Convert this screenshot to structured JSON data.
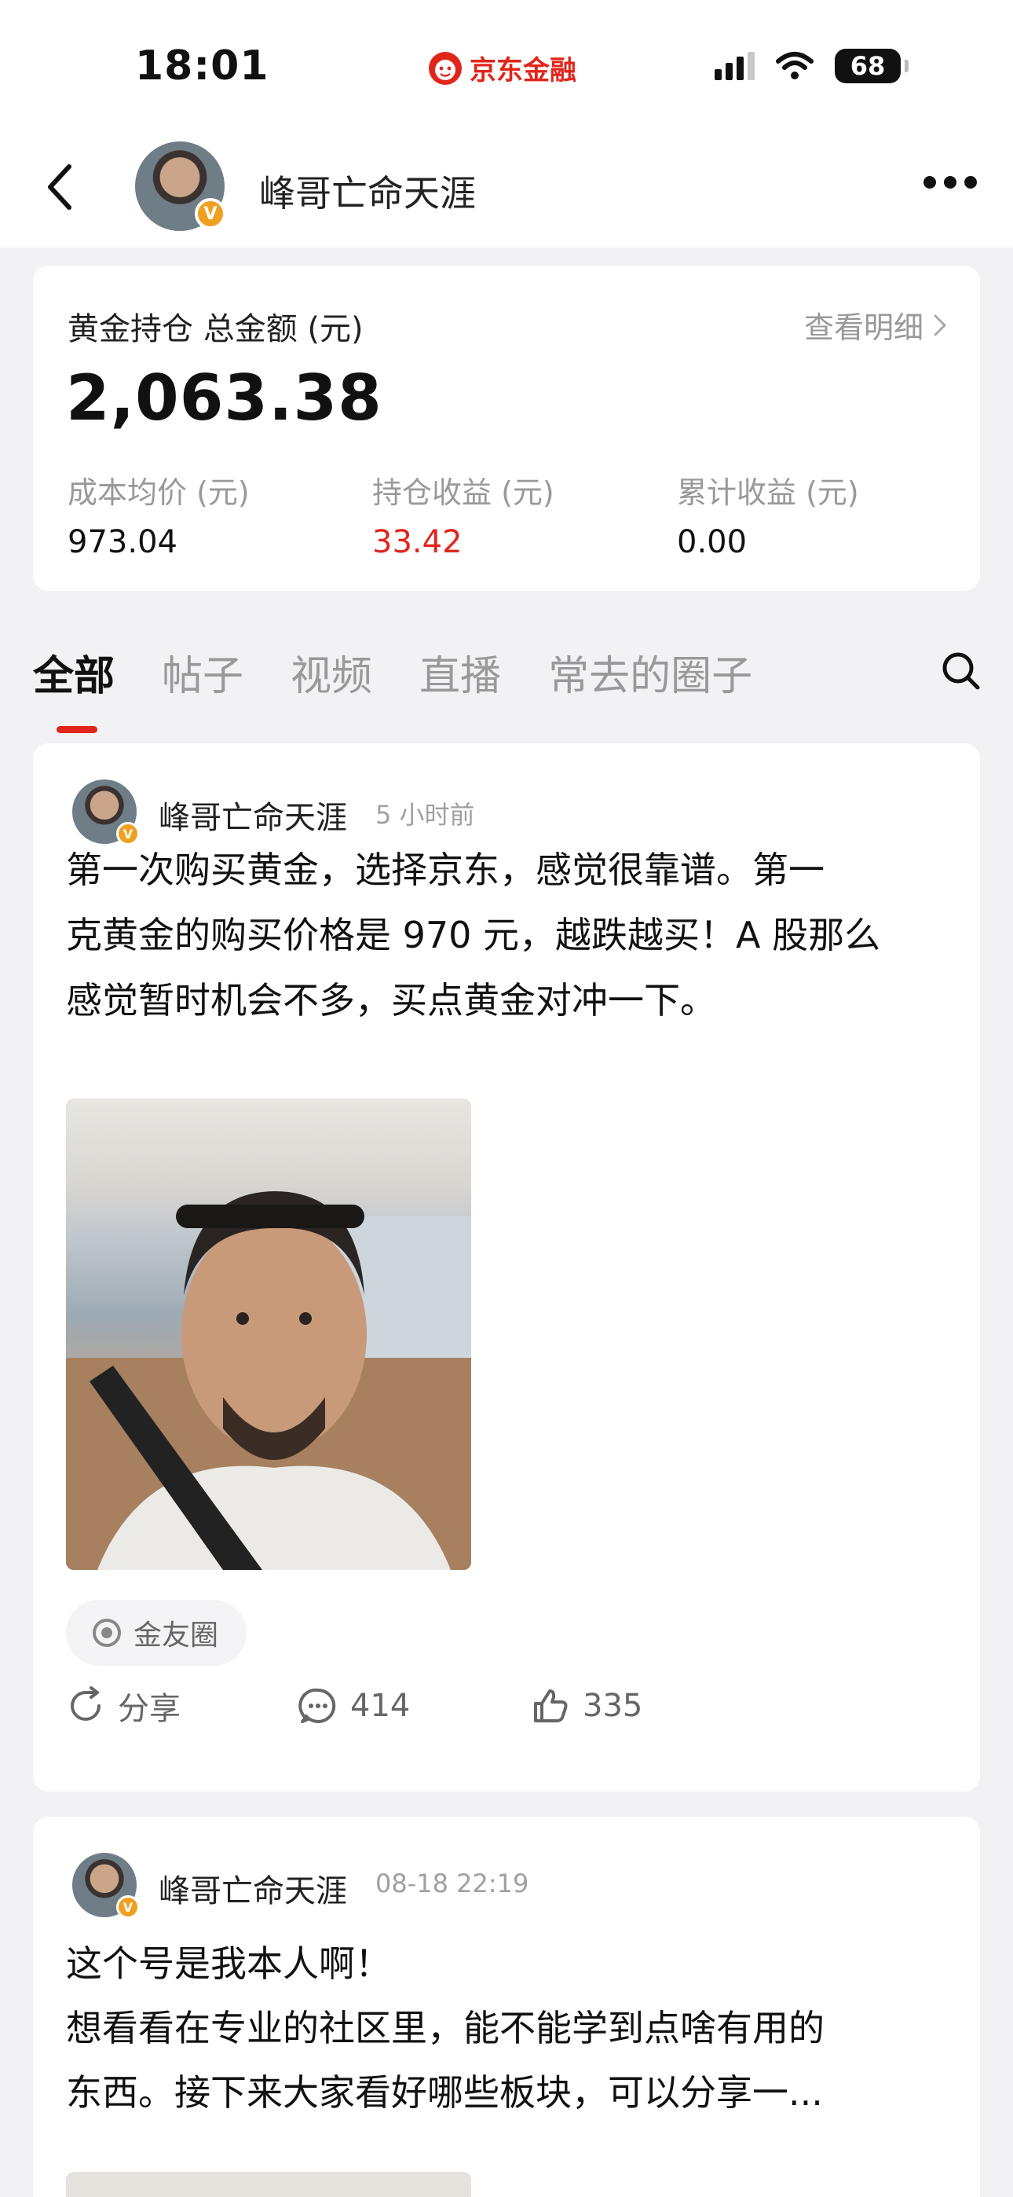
{
  "status_bar": {
    "time": "18:01",
    "brand": "京东金融",
    "battery": "68",
    "icons": [
      "signal-icon",
      "wifi-icon",
      "battery-icon"
    ]
  },
  "header": {
    "user_name": "峰哥亡命天涯",
    "badge": "V",
    "icons": [
      "back-arrow-icon",
      "more-dots-icon"
    ]
  },
  "holdings": {
    "title": "黄金持仓 总金额 (元)",
    "detail_link": "查看明细",
    "total_amount": "2,063.38",
    "stats": [
      {
        "label": "成本均价 (元)",
        "value": "973.04"
      },
      {
        "label": "持仓收益 (元)",
        "value": "33.42"
      },
      {
        "label": "累计收益 (元)",
        "value": "0.00"
      }
    ]
  },
  "tabs": [
    "全部",
    "帖子",
    "视频",
    "直播",
    "常去的圈子"
  ],
  "active_tab": "全部",
  "posts": [
    {
      "author": "峰哥亡命天涯",
      "time": "5 小时前",
      "text_lines": [
        "第一次购买黄金，选择京东，感觉很靠谱。第一",
        "克黄金的购买价格是 970 元，越跌越买！A 股那么",
        "感觉暂时机会不多，买点黄金对冲一下。"
      ],
      "tag": "金友圈",
      "share_label": "分享",
      "comments": "414",
      "likes": "335"
    },
    {
      "author": "峰哥亡命天涯",
      "time": "08-18 22:19",
      "text_lines": [
        "这个号是我本人啊！",
        "想看看在专业的社区里，能不能学到点啥有用的",
        "东西。接下来大家看好哪些板块，可以分享一..."
      ]
    }
  ],
  "colors": {
    "accent": "#e1251b",
    "muted": "#999999",
    "background": "#f2f2f4"
  }
}
